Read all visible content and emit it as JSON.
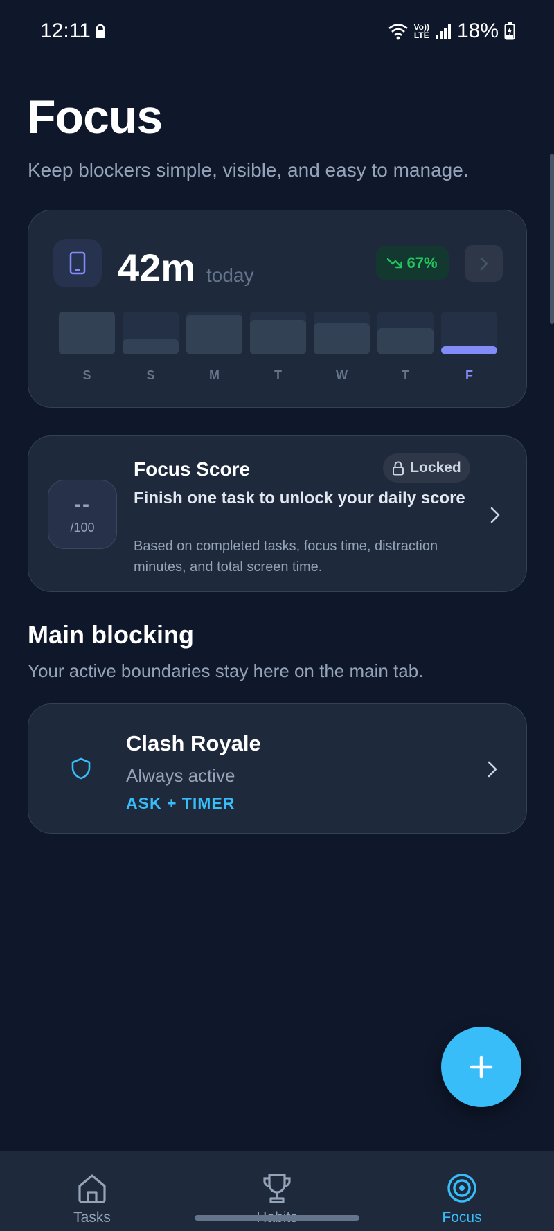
{
  "status_bar": {
    "time": "12:11",
    "battery": "18%",
    "network_top": "Vo))",
    "network_bottom": "LTE"
  },
  "header": {
    "title": "Focus",
    "subtitle": "Keep blockers simple, visible, and easy to manage."
  },
  "screen_time": {
    "value": "42m",
    "suffix": "today",
    "trend": "67%",
    "trend_color": "#22c55e",
    "days": [
      {
        "label": "S",
        "fill": 1.0,
        "active": false
      },
      {
        "label": "S",
        "fill": 0.35,
        "active": false
      },
      {
        "label": "M",
        "fill": 0.92,
        "active": false
      },
      {
        "label": "T",
        "fill": 0.8,
        "active": false
      },
      {
        "label": "W",
        "fill": 0.72,
        "active": false
      },
      {
        "label": "T",
        "fill": 0.62,
        "active": false
      },
      {
        "label": "F",
        "fill": 0.2,
        "active": true
      }
    ]
  },
  "focus_score": {
    "title": "Focus Score",
    "value": "--",
    "max": "/100",
    "locked_label": "Locked",
    "headline": "Finish one task to unlock your daily score",
    "description": "Based on completed tasks, focus time, distraction minutes, and total screen time."
  },
  "main_blocking": {
    "title": "Main blocking",
    "subtitle": "Your active boundaries stay here on the main tab.",
    "blockers": [
      {
        "name": "Clash Royale",
        "status": "Always active",
        "mode": "ASK + TIMER"
      }
    ]
  },
  "bottom_nav": {
    "items": [
      {
        "label": "Tasks",
        "icon": "home-icon",
        "active": false
      },
      {
        "label": "Habits",
        "icon": "trophy-icon",
        "active": false
      },
      {
        "label": "Focus",
        "icon": "target-icon",
        "active": true
      }
    ]
  },
  "colors": {
    "background": "#0f172a",
    "card": "#1e293b",
    "accent": "#38bdf8",
    "chart_active": "#818cf8"
  }
}
